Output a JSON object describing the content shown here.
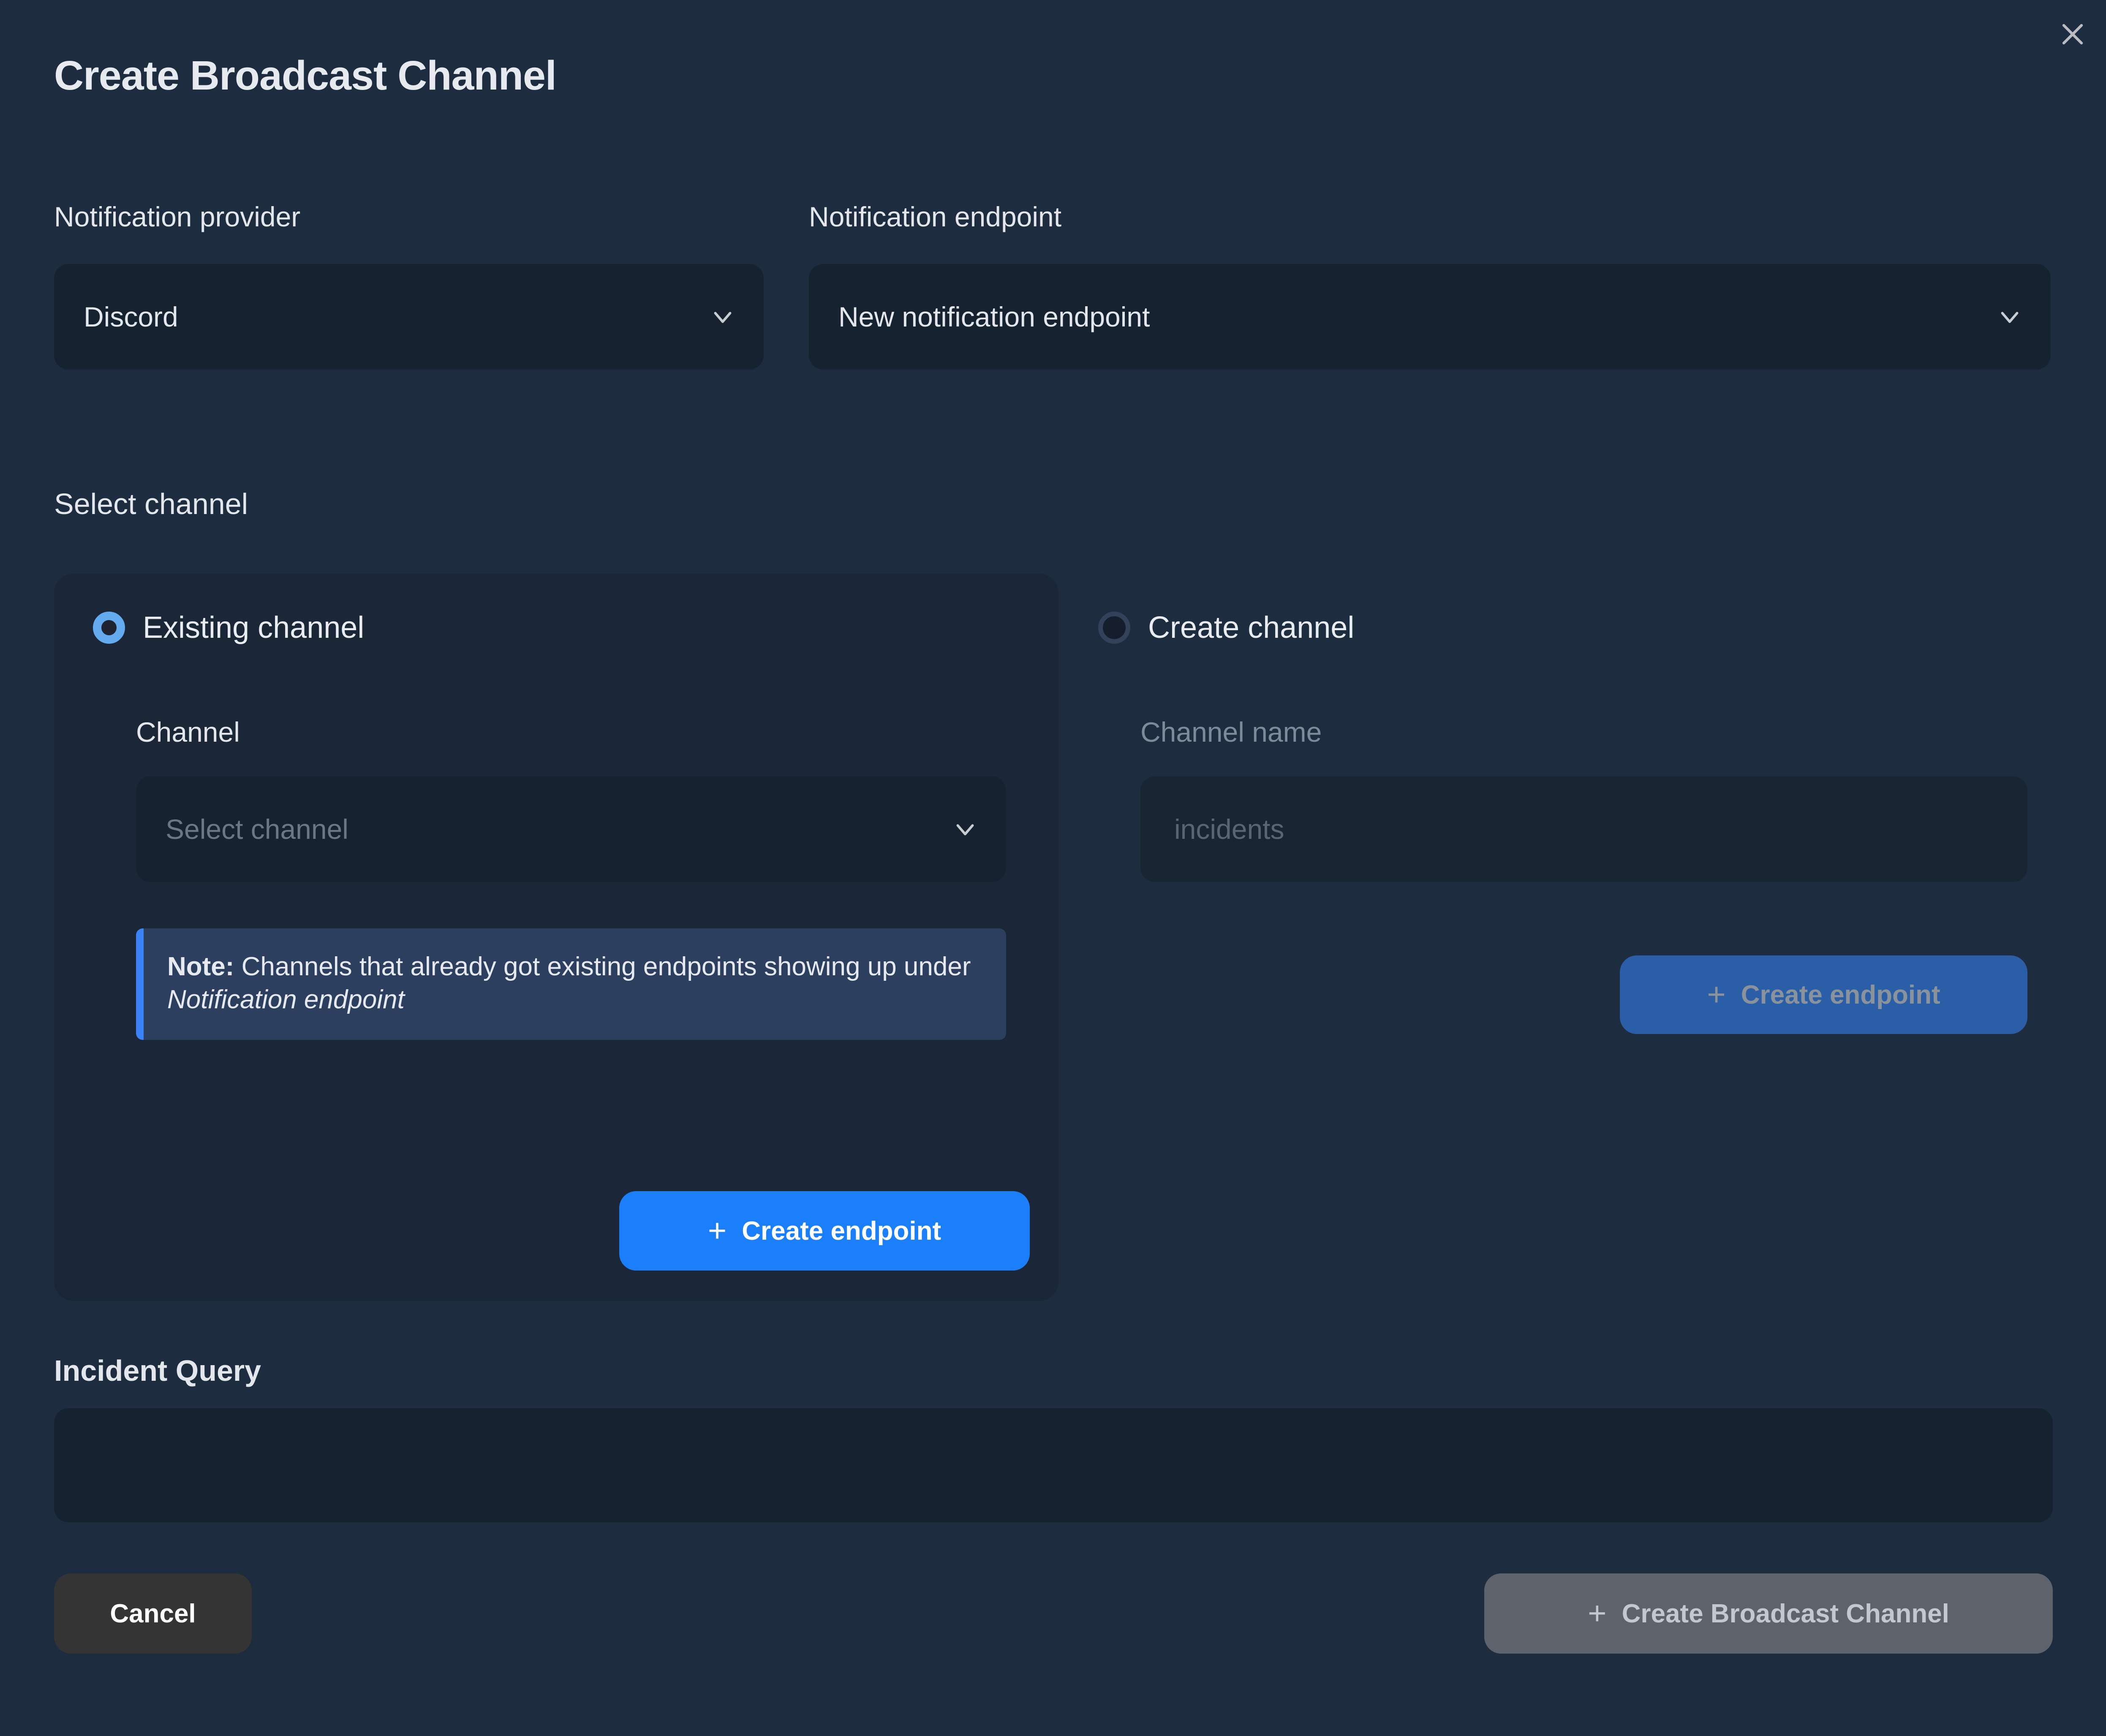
{
  "dialog": {
    "title": "Create Broadcast Channel",
    "close_icon": "close-icon"
  },
  "fields": {
    "provider_label": "Notification provider",
    "provider_value": "Discord",
    "endpoint_label": "Notification endpoint",
    "endpoint_value": "New notification endpoint"
  },
  "select_channel": {
    "section_label": "Select channel",
    "existing": {
      "radio_label": "Existing channel",
      "selected": true,
      "channel_label": "Channel",
      "channel_placeholder": "Select channel",
      "note_prefix": "Note:",
      "note_body": " Channels that already got existing endpoints showing up under ",
      "note_italic": "Notification endpoint",
      "create_endpoint_label": "Create endpoint",
      "plus": "+"
    },
    "create": {
      "radio_label": "Create channel",
      "selected": false,
      "channel_name_label": "Channel name",
      "channel_name_placeholder": "incidents",
      "create_endpoint_label": "Create endpoint",
      "plus": "+"
    }
  },
  "incident_query": {
    "label": "Incident Query",
    "value": "",
    "placeholder": ""
  },
  "footer": {
    "cancel_label": "Cancel",
    "submit_label": "Create Broadcast Channel",
    "plus": "+"
  },
  "colors": {
    "page_bg": "#1D2D3F",
    "control_bg": "#16222F",
    "card_bg": "#1B2636",
    "accent_blue": "#1B7FFB",
    "radio_blue": "#63AAEE",
    "note_bg": "#2C3F5E",
    "note_border": "#3B82F6",
    "disabled_gray": "#5D626C",
    "cancel_gray": "#343434"
  }
}
